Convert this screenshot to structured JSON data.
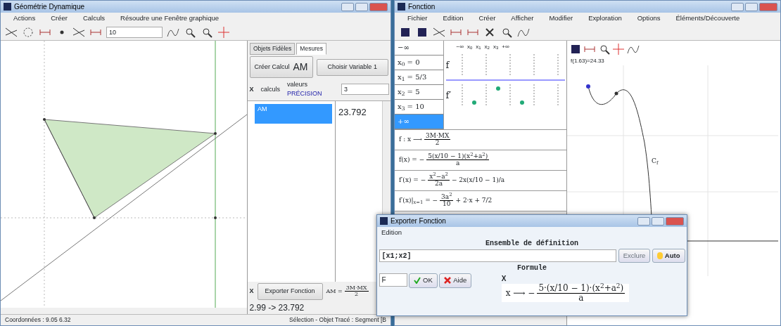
{
  "geometry_window": {
    "title": "Géométrie Dynamique",
    "menu": [
      "Actions",
      "Créer",
      "Calculs",
      "Résoudre une Fenêtre graphique"
    ],
    "toolbar_field": "10",
    "panel": {
      "tabs": [
        {
          "label": "Objets Fidèles",
          "selected": false
        },
        {
          "label": "Mesures",
          "selected": true
        }
      ],
      "create_button": "Créer Calcul",
      "create_value": "AM",
      "variable_button": "Choisir Variable 1",
      "close_mark": "X",
      "calc_label": "calculs",
      "values_label": "valeurs",
      "precision_label": "PRÉCISION",
      "precision_value": "3",
      "list": [
        {
          "label": "AM",
          "selected": true
        }
      ],
      "value": "23.792",
      "export_close": "X",
      "export_button": "Exporter Fonction",
      "formula": {
        "lead": "AM =",
        "num": "3M·MX",
        "den": "2"
      },
      "result": "2.99 -> 23.792"
    },
    "status_left": "Coordonnées : 9.05 6.32",
    "status_right": "Sélection - Objet Tracé : Segment [B"
  },
  "function_window": {
    "title": "Fonction",
    "menu": [
      "Fichier",
      "Edition",
      "Créer",
      "Afficher",
      "Modifier",
      "Exploration",
      "Options",
      "Éléments/Découverte"
    ],
    "values": [
      {
        "label": "−∞",
        "selected": false
      },
      {
        "label": "x$_{0}$ = 0",
        "selected": false
      },
      {
        "label": "x$_{1}$ = 5/3",
        "selected": false
      },
      {
        "label": "x$_{2}$ = 5",
        "selected": false
      },
      {
        "label": "x$_{3}$ = 10",
        "selected": false
      },
      {
        "label": "+∞",
        "selected": true
      }
    ],
    "variation_header": [
      "−∞",
      "x$_{0}$",
      "x$_{1}$",
      "x$_{2}$",
      "x$_{3}$",
      "+∞"
    ],
    "variation_rows": [
      "f",
      "f′"
    ],
    "formulas": [
      {
        "lead": "f : x ⟶",
        "num": "3M·MX",
        "den": "2"
      },
      {
        "lead": "f(x) = −",
        "num": "5(x/10 − 1)(x$^{2}$+a$^{2}$)",
        "den": "a"
      },
      {
        "lead": "f′(x) = −",
        "num": "x$^{2}$−a$^{2}$",
        "den": "2a",
        "tail": "− 2x(x/10 − 1)/a"
      },
      {
        "lead": "f′(x)|$_{x=1}$ = −",
        "num": "3a$^{2}$",
        "den": "10",
        "tail": "+ 2·x + 7/2"
      }
    ],
    "graph_label": "f(1.63)=24.33",
    "curve_label": "C$_{f}$"
  },
  "export_dialog": {
    "title": "Exporter Fonction",
    "menu": [
      "Edition"
    ],
    "domain_heading": "Ensemble de définition",
    "domain_value": "[x1;x2]",
    "exclude_button": "Exclure",
    "auto_button": "Auto",
    "formula_heading": "Formule",
    "select_value": "F",
    "ok_button": "OK",
    "cancel_button": "Aide",
    "close_mark": "X",
    "formula": {
      "lead": "x ⟶ −",
      "num": "5·(x/10 − 1)·(x$^{2}$+a$^{2}$)",
      "den": "a"
    }
  }
}
